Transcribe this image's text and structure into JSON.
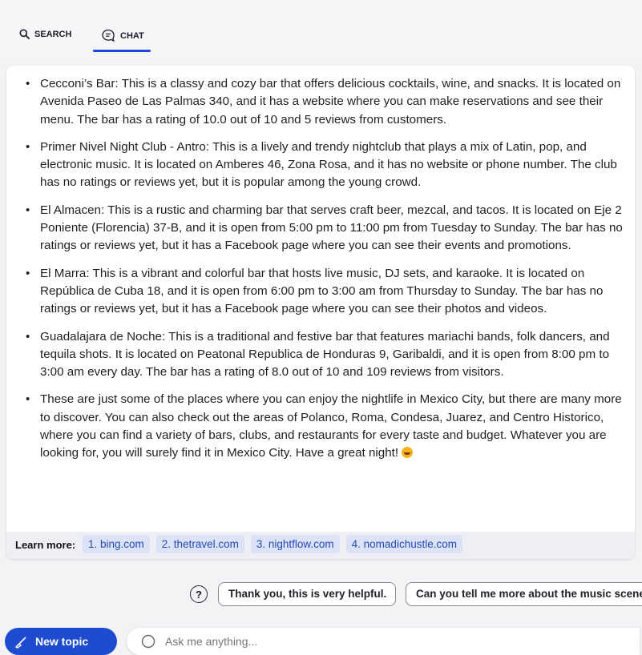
{
  "tabs": {
    "search_label": "SEARCH",
    "chat_label": "CHAT"
  },
  "results": [
    "Cecconi’s Bar: This is a classy and cozy bar that offers delicious cocktails, wine, and snacks. It is located on Avenida Paseo de Las Palmas 340, and it has a website where you can make reservations and see their menu. The bar has a rating of 10.0 out of 10 and 5 reviews from customers.",
    "Primer Nivel Night Club - Antro: This is a lively and trendy nightclub that plays a mix of Latin, pop, and electronic music. It is located on Amberes 46, Zona Rosa, and it has no website or phone number. The club has no ratings or reviews yet, but it is popular among the young crowd.",
    "El Almacen: This is a rustic and charming bar that serves craft beer, mezcal, and tacos. It is located on Eje 2 Poniente (Florencia) 37-B, and it is open from 5:00 pm to 11:00 pm from Tuesday to Sunday. The bar has no ratings or reviews yet, but it has a Facebook page where you can see their events and promotions.",
    "El Marra: This is a vibrant and colorful bar that hosts live music, DJ sets, and karaoke. It is located on República de Cuba 18, and it is open from 6:00 pm to 3:00 am from Thursday to Sunday. The bar has no ratings or reviews yet, but it has a Facebook page where you can see their photos and videos.",
    "Guadalajara de Noche: This is a traditional and festive bar that features mariachi bands, folk dancers, and tequila shots. It is located on Peatonal Republica de Honduras 9, Garibaldi, and it is open from 8:00 pm to 3:00 am every day. The bar has a rating of 8.0 out of 10 and 109 reviews from visitors.",
    "These are just some of the places where you can enjoy the nightlife in Mexico City, but there are many more to discover. You can also check out the areas of Polanco, Roma, Condesa, Juarez, and Centro Historico, where you can find a variety of bars, clubs, and restaurants for every taste and budget. Whatever you are looking for, you will surely find it in Mexico City. Have a great night!"
  ],
  "learn_more": {
    "label": "Learn more:",
    "links": [
      "1. bing.com",
      "2. thetravel.com",
      "3. nightflow.com",
      "4. nomadichustle.com"
    ]
  },
  "suggestions": {
    "help_icon": "?",
    "items": [
      "Thank you, this is very helpful.",
      "Can you tell me more about the music scene"
    ]
  },
  "composer": {
    "new_topic_label": "New topic",
    "placeholder": "Ask me anything..."
  },
  "colors": {
    "accent": "#1e4bd0",
    "link_bg": "#dde3f6",
    "link_text": "#2449b8",
    "emoji": "#f5b31f"
  },
  "icons": {
    "search": "search-icon",
    "chat": "chat-bubble-icon",
    "help": "question-circle-icon",
    "new_topic": "broom-icon",
    "emoji": "smiley-emoji-icon"
  }
}
